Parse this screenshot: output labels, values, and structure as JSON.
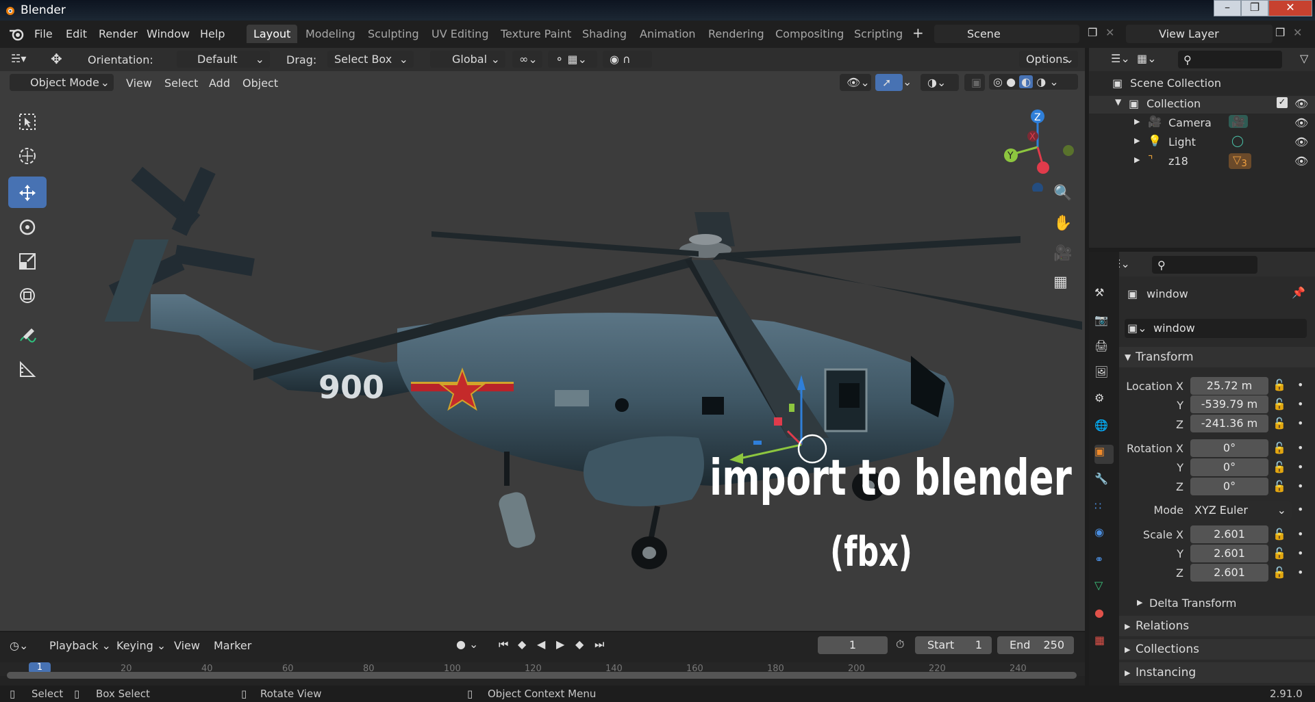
{
  "window": {
    "title": "Blender"
  },
  "menu": [
    "File",
    "Edit",
    "Render",
    "Window",
    "Help"
  ],
  "workspaces": [
    "Layout",
    "Modeling",
    "Sculpting",
    "UV Editing",
    "Texture Paint",
    "Shading",
    "Animation",
    "Rendering",
    "Compositing",
    "Scripting"
  ],
  "scene": {
    "label": "Scene",
    "view_layer": "View Layer"
  },
  "tool_header": {
    "orientation_label": "Orientation:",
    "orientation_value": "Default",
    "drag_label": "Drag:",
    "drag_value": "Select Box",
    "transform_value": "Global",
    "options_label": "Options"
  },
  "viewport_header": {
    "mode": "Object Mode",
    "menus": [
      "View",
      "Select",
      "Add",
      "Object"
    ]
  },
  "overlay": {
    "title": "import to blender",
    "subtitle": "(fbx)"
  },
  "model": {
    "tail_number": "900"
  },
  "gizmo": {
    "x": "X",
    "y": "Y",
    "z": "Z"
  },
  "outliner": {
    "root": "Scene Collection",
    "collection": "Collection",
    "items": [
      {
        "name": "Camera"
      },
      {
        "name": "Light"
      },
      {
        "name": "z18",
        "badge": "3"
      }
    ]
  },
  "properties": {
    "object_name": "window",
    "data_name": "window",
    "transform_title": "Transform",
    "location": {
      "x_label": "Location X",
      "x": "25.72 m",
      "y_label": "Y",
      "y": "-539.79 m",
      "z_label": "Z",
      "z": "-241.36 m"
    },
    "rotation": {
      "x_label": "Rotation X",
      "x": "0°",
      "y_label": "Y",
      "y": "0°",
      "z_label": "Z",
      "z": "0°"
    },
    "mode_label": "Mode",
    "mode_value": "XYZ Euler",
    "scale": {
      "x_label": "Scale X",
      "x": "2.601",
      "y_label": "Y",
      "y": "2.601",
      "z_label": "Z",
      "z": "2.601"
    },
    "delta": "Delta Transform",
    "sections": [
      "Relations",
      "Collections",
      "Instancing"
    ]
  },
  "timeline": {
    "menus": [
      "Playback",
      "Keying",
      "View",
      "Marker"
    ],
    "current_frame": "1",
    "start_label": "Start",
    "start": "1",
    "end_label": "End",
    "end": "250",
    "ruler": [
      "1",
      "20",
      "40",
      "60",
      "80",
      "100",
      "120",
      "140",
      "160",
      "180",
      "200",
      "220",
      "240"
    ]
  },
  "status": {
    "select": "Select",
    "box_select": "Box Select",
    "rotate_view": "Rotate View",
    "context_menu": "Object Context Menu",
    "version": "2.91.0"
  }
}
